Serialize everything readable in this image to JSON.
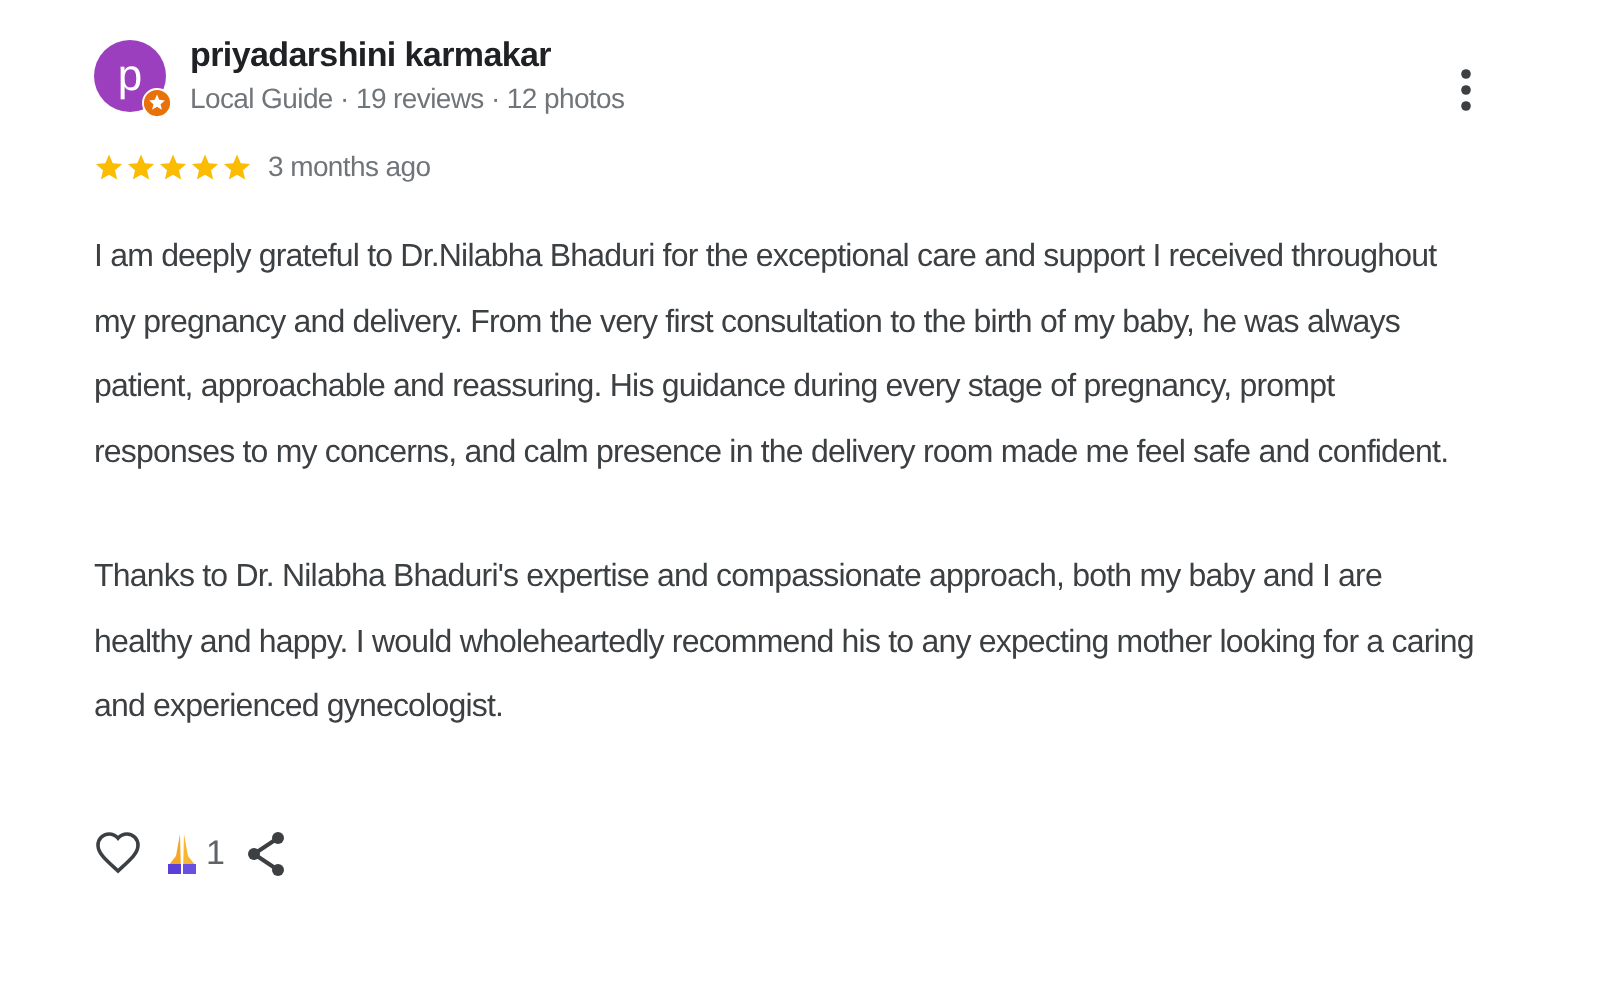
{
  "review": {
    "author": {
      "name": "priyadarshini karmakar",
      "initial": "p",
      "local_guide": true,
      "meta": "Local Guide · 19 reviews · 12 photos"
    },
    "stars": 5,
    "time": "3 months ago",
    "paragraphs": [
      "I am deeply grateful to Dr.Nilabha Bhaduri for the exceptional care and support I received throughout my pregnancy and delivery. From the very first consultation to the birth of my baby, he was always patient, approachable and reassuring. His guidance during every stage of pregnancy, prompt responses to my concerns, and calm presence in the delivery room made me feel safe and confident.",
      "Thanks to Dr. Nilabha Bhaduri's expertise and compassionate approach, both my baby and I are healthy and happy. I would wholeheartedly recommend his to any expecting mother looking for a caring and experienced gynecologist."
    ],
    "reactions": {
      "count": "1"
    }
  }
}
